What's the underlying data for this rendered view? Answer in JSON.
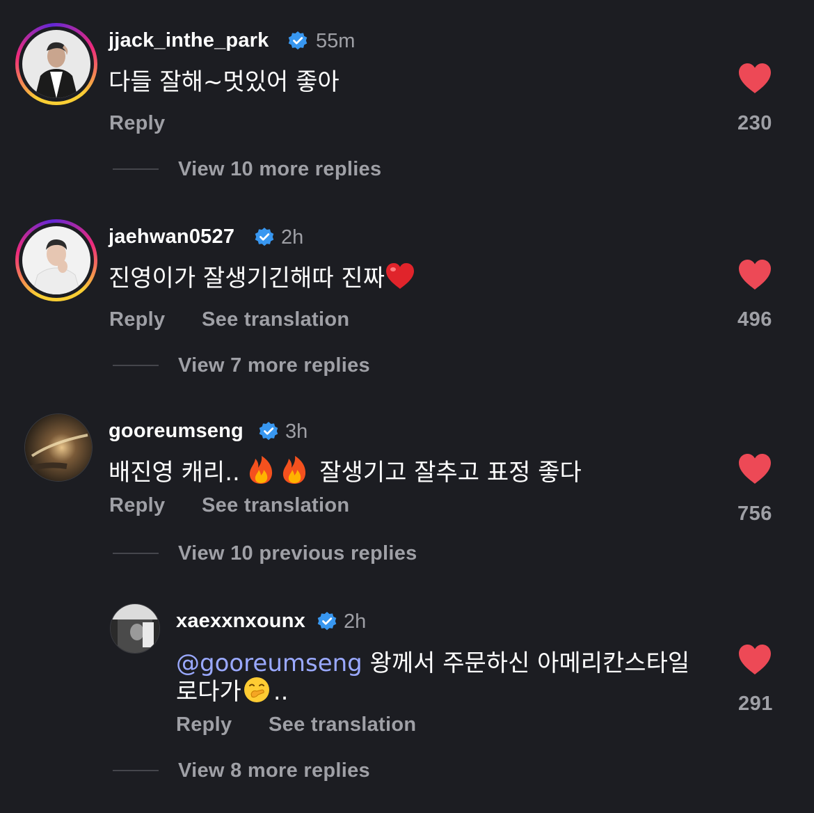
{
  "colors": {
    "background": "#1c1d22",
    "heart": "#ed4956",
    "verified": "#3897f0",
    "secondary_text": "#9fa0a6",
    "mention": "#9aa9ff"
  },
  "comments": [
    {
      "username": "jjack_inthe_park",
      "verified_icon": "verified-badge-icon",
      "time": "55m",
      "text": "다들 잘해~멋있어 좋아",
      "reply_label": "Reply",
      "likes": "230",
      "view_replies": "View 10 more replies"
    },
    {
      "username": "jaehwan0527",
      "verified_icon": "verified-badge-icon",
      "time": "2h",
      "text": "진영이가 잘생기긴해따 진짜",
      "emoji": "heart-emoji",
      "reply_label": "Reply",
      "translate_label": "See translation",
      "likes": "496",
      "view_replies": "View 7 more replies"
    },
    {
      "username": "gooreumseng",
      "verified_icon": "verified-badge-icon",
      "time": "3h",
      "text_part1": "배진영 캐리..",
      "text_part2": "잘생기고 잘추고 표정 좋다",
      "emoji": "fire-emoji",
      "reply_label": "Reply",
      "translate_label": "See translation",
      "likes": "756",
      "view_replies": "View 10 previous replies",
      "reply": {
        "username": "xaexxnxounx",
        "verified_icon": "verified-badge-icon",
        "time": "2h",
        "mention": "@gooreumseng",
        "text_line1": "왕께서 주문하신 아메리칸스타일",
        "text_line2": "로다가",
        "text_line2_end": "..",
        "emoji": "hand-over-mouth-emoji",
        "reply_label": "Reply",
        "translate_label": "See translation",
        "likes": "291"
      },
      "view_more_replies": "View 8 more replies"
    }
  ]
}
